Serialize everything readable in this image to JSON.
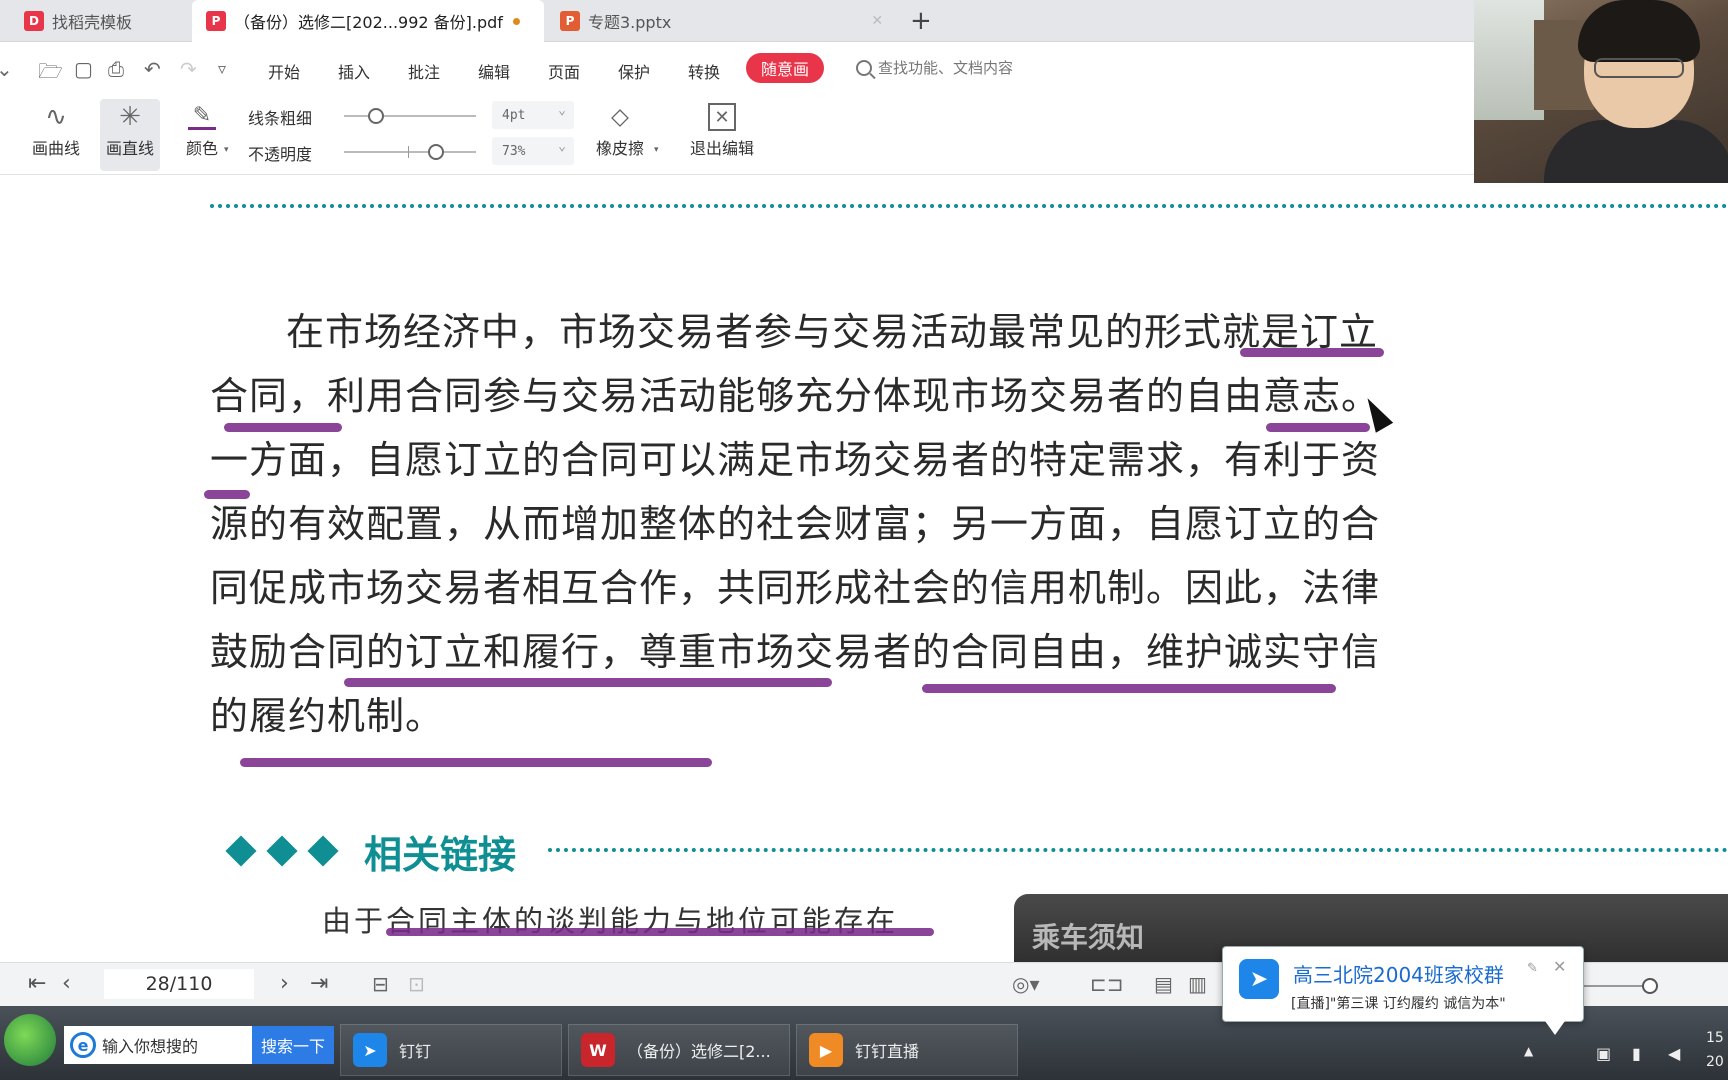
{
  "tabs": [
    {
      "label": "找稻壳模板",
      "color": "#e8354a",
      "glyph": "D"
    },
    {
      "label": "（备份）选修二[202...992 备份].pdf",
      "color": "#e8354a",
      "glyph": "P",
      "active": true
    },
    {
      "label": "专题3.pptx",
      "color": "#e25d34",
      "glyph": "P"
    }
  ],
  "menu": {
    "items": [
      "开始",
      "插入",
      "批注",
      "编辑",
      "页面",
      "保护",
      "转换"
    ],
    "highlight": "随意画",
    "search_placeholder": "查找功能、文档内容"
  },
  "draw_toolbar": {
    "curve": "画曲线",
    "line": "画直线",
    "color": "颜色",
    "thickness_label": "线条粗细",
    "thickness_value": "4pt",
    "opacity_label": "不透明度",
    "opacity_value": "73%",
    "eraser": "橡皮擦",
    "exit": "退出编辑"
  },
  "document": {
    "paragraph": "在市场经济中，市场交易者参与交易活动最常见的形式就是订立合同，利用合同参与交易活动能够充分体现市场交易者的自由意志。一方面，自愿订立的合同可以满足市场交易者的特定需求，有利于资源的有效配置，从而增加整体的社会财富；另一方面，自愿订立的合同促成市场交易者相互合作，共同形成社会的信用机制。因此，法律鼓励合同的订立和履行，尊重市场交易者的合同自由，维护诚实守信的履约机制。",
    "section_title": "相关链接",
    "sub_text": "由于合同主体的谈判能力与地位可能存在",
    "photo_text": "乘车须知",
    "underline_color": "#7a2b8a",
    "accent_color": "#0f8e93"
  },
  "statusbar": {
    "page": "28/110"
  },
  "taskbar": {
    "search_placeholder": "输入你想搜的",
    "search_button": "搜索一下",
    "apps": [
      {
        "label": "钉钉",
        "color": "#1d86e8"
      },
      {
        "label": "（备份）选修二[2...",
        "color": "#c9252c"
      },
      {
        "label": "钉钉直播",
        "color": "#f08a24"
      }
    ],
    "clock": "15",
    "date": "20"
  },
  "notification": {
    "title": "高三北院2004班家校群",
    "message": "[直播]\"第三课 订约履约 诚信为本\""
  }
}
